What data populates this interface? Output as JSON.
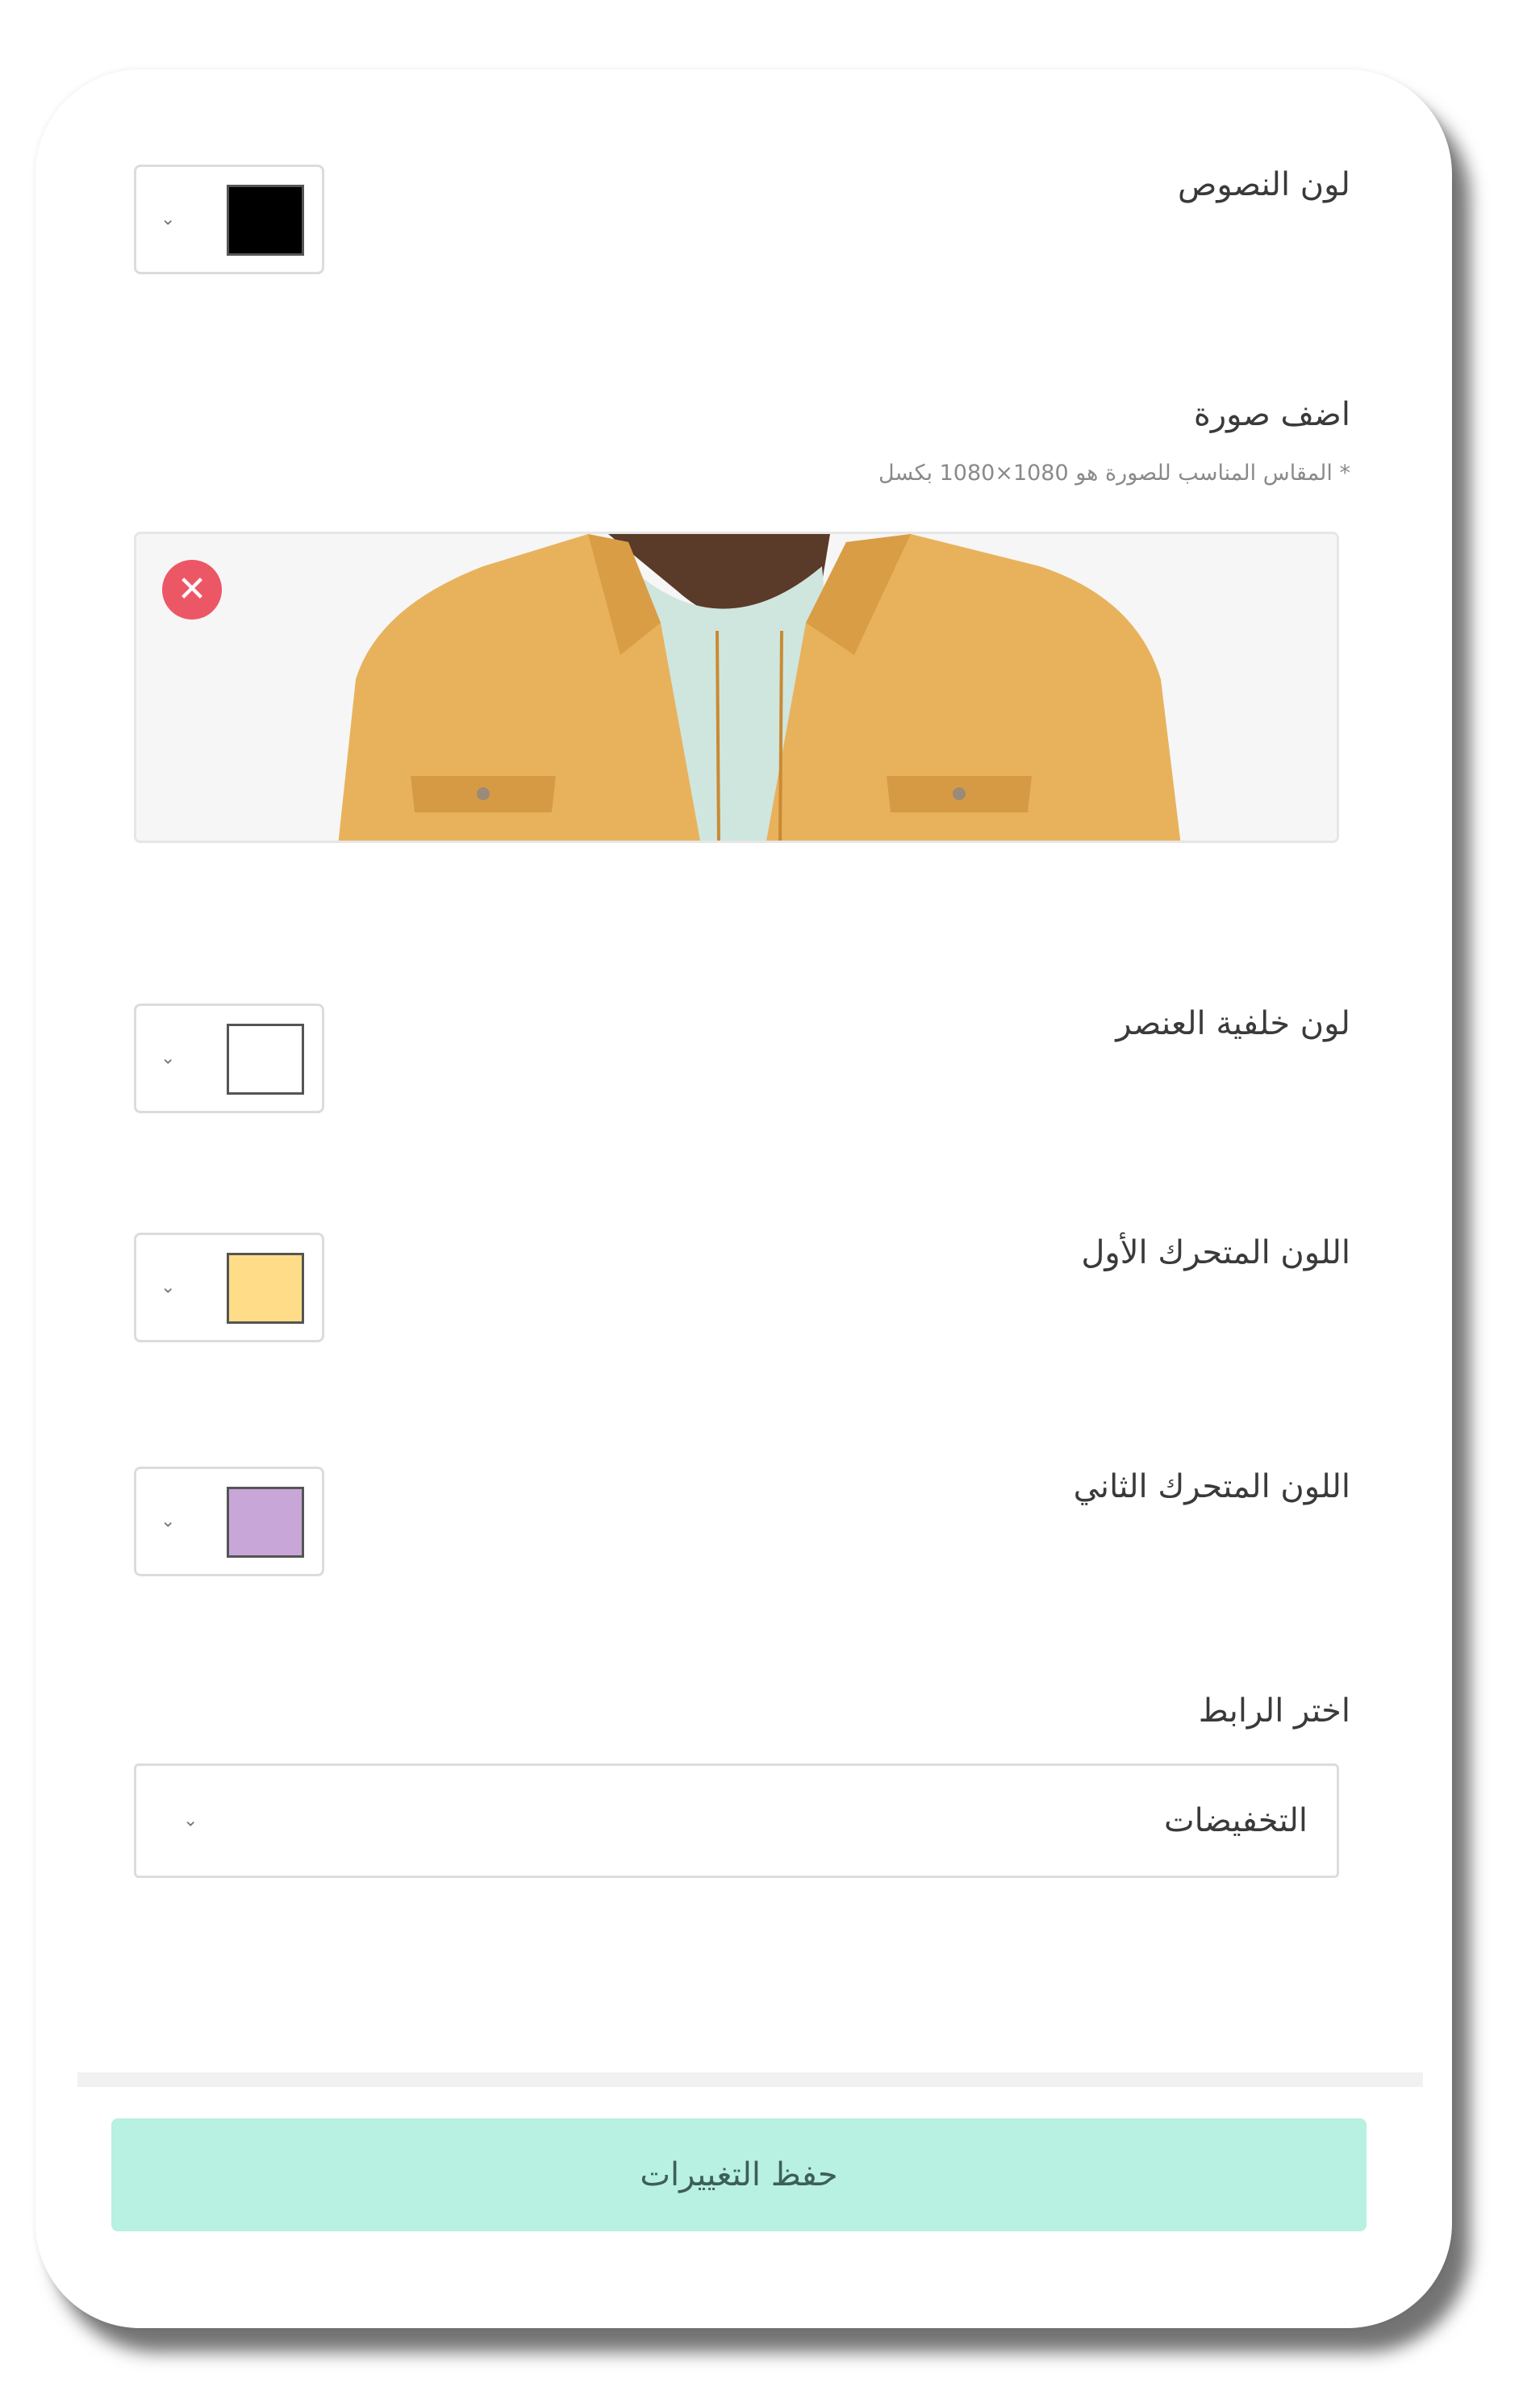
{
  "text_color": {
    "label": "لون النصوص",
    "swatch": "#000000"
  },
  "image": {
    "label": "اضف صورة",
    "hint": "* المقاس المناسب للصورة هو 1080×1080 بكسل",
    "remove_symbol": "✕"
  },
  "background_color": {
    "label": "لون خلفية العنصر",
    "swatch": "#ffffff"
  },
  "animated_first": {
    "label": "اللون المتحرك الأول",
    "swatch": "#ffdd88"
  },
  "animated_second": {
    "label": "اللون المتحرك الثاني",
    "swatch": "#c8a6d8"
  },
  "link": {
    "label": "اختر الرابط",
    "selected": "التخفيضات"
  },
  "save_label": "حفظ التغييرات",
  "chevron": "⌄"
}
